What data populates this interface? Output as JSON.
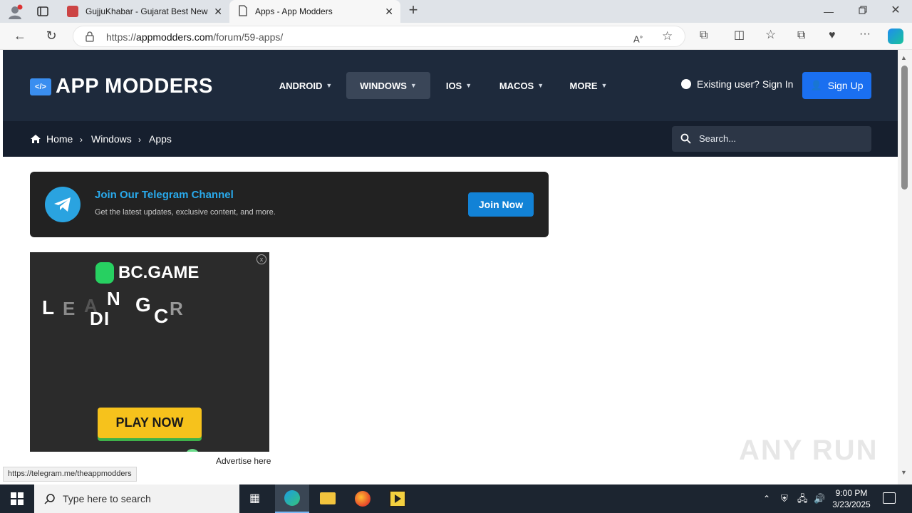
{
  "browser": {
    "tabs": [
      {
        "title": "GujjuKhabar - Gujarat Best News",
        "active": false
      },
      {
        "title": "Apps - App Modders",
        "active": true
      }
    ],
    "url_prefix": "https://",
    "url_host": "appmodders.com",
    "url_path": "/forum/59-apps/"
  },
  "site": {
    "logo": "APP MODDERS",
    "nav": [
      "ANDROID",
      "WINDOWS",
      "IOS",
      "MACOS",
      "MORE"
    ],
    "active_nav": "WINDOWS",
    "signin": "Existing user? Sign In",
    "signup": "Sign Up",
    "breadcrumb": [
      "Home",
      "Windows",
      "Apps"
    ],
    "search_placeholder": "Search..."
  },
  "telegram": {
    "title": "Join Our Telegram Channel",
    "subtitle": "Get the latest updates, exclusive content, and more.",
    "button": "Join Now"
  },
  "ad": {
    "brand": "BC.GAME",
    "letters": [
      "L",
      "E",
      "A",
      "D",
      "I",
      "N",
      "G",
      "C",
      "R"
    ],
    "cta": "PLAY NOW",
    "advertise": "Advertise here"
  },
  "status_link": "https://telegram.me/theappmodders",
  "taskbar": {
    "search_placeholder": "Type here to search",
    "time": "9:00 PM",
    "date": "3/23/2025"
  },
  "watermark": "ANY RUN",
  "colors": {
    "header_bg": "#1e2a3c",
    "breadcrumb_bg": "#161f2e",
    "signup_bg": "#1a6ff0",
    "telegram_title": "#29a9eb",
    "join_button": "#1282d6",
    "ad_cta": "#f6c21c"
  }
}
